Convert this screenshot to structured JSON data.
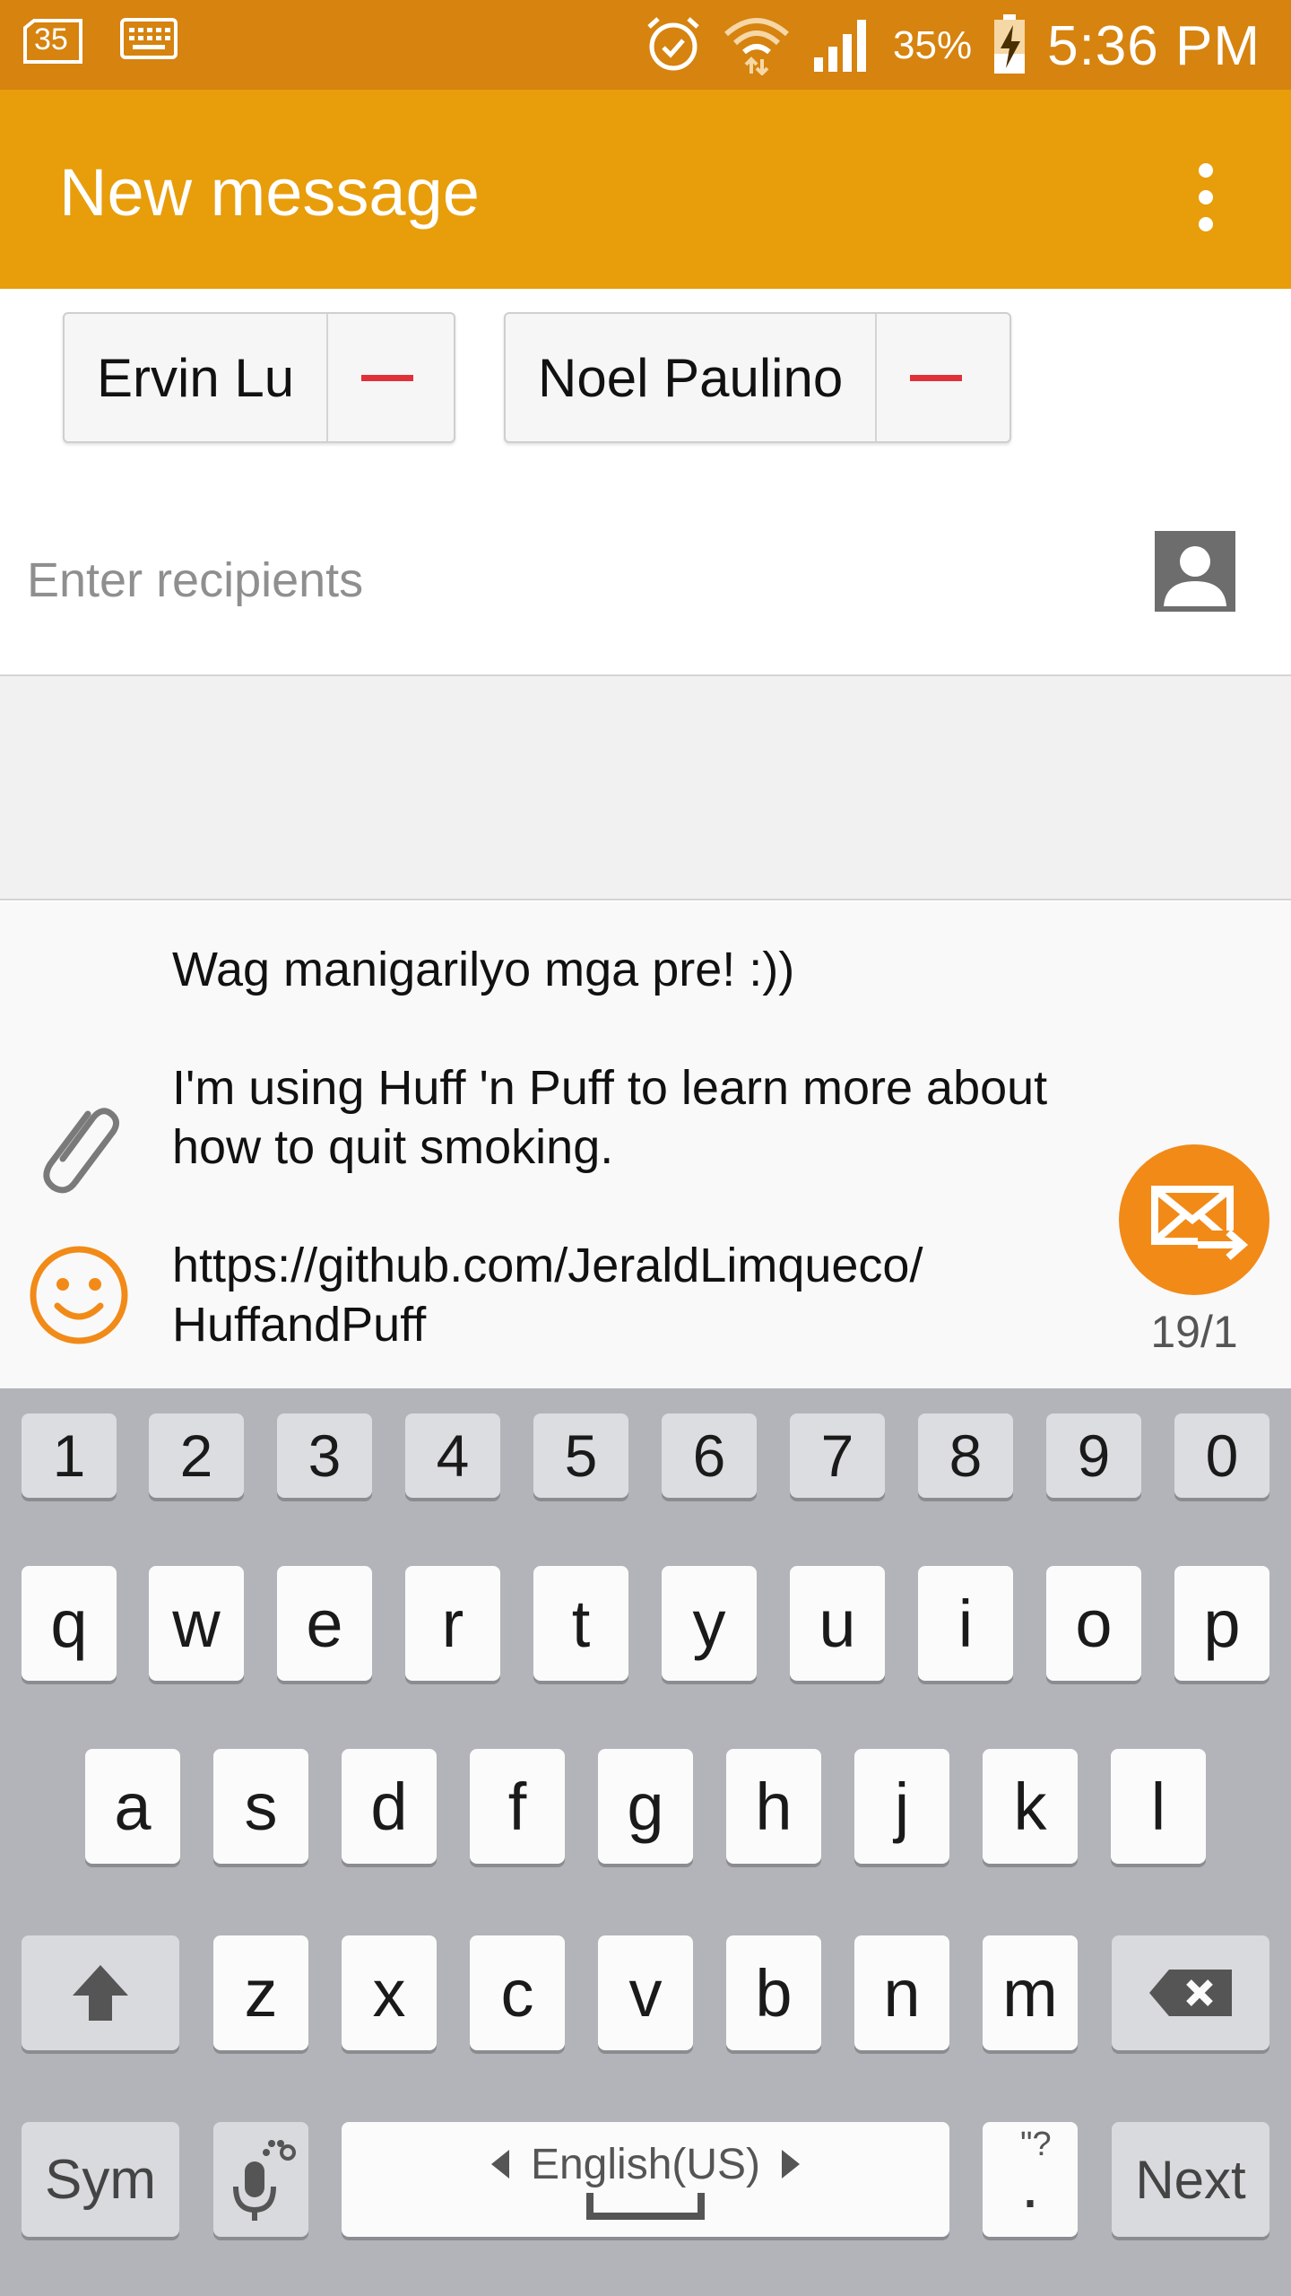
{
  "status_bar": {
    "notif_count": "35",
    "battery_percent": "35%",
    "time": "5:36 PM",
    "battery_level": 0.35,
    "icons": [
      "sim-badge-icon",
      "keyboard-icon",
      "alarm-icon",
      "wifi-icon",
      "signal-icon",
      "battery-charging-icon"
    ]
  },
  "app_bar": {
    "title": "New message",
    "menu_icon": "more-vert-icon"
  },
  "recipients": {
    "chips": [
      {
        "name": "Ervin Lu"
      },
      {
        "name": "Noel Paulino"
      }
    ],
    "input_placeholder": "Enter recipients",
    "contact_icon": "contact-picker-icon"
  },
  "compose": {
    "line1": "Wag manigarilyo mga pre! :))",
    "line2": "I'm using Huff 'n Puff to learn more about\nhow to quit smoking.",
    "line3": "https://github.com/JeraldLimqueco/\nHuffandPuff",
    "counter": "19/1",
    "attach_icon": "paperclip-icon",
    "emoji_icon": "smiley-icon",
    "send_icon": "send-mail-icon"
  },
  "keyboard": {
    "numbers": [
      "1",
      "2",
      "3",
      "4",
      "5",
      "6",
      "7",
      "8",
      "9",
      "0"
    ],
    "row1": [
      "q",
      "w",
      "e",
      "r",
      "t",
      "y",
      "u",
      "i",
      "o",
      "p"
    ],
    "row2": [
      "a",
      "s",
      "d",
      "f",
      "g",
      "h",
      "j",
      "k",
      "l"
    ],
    "row3": [
      "z",
      "x",
      "c",
      "v",
      "b",
      "n",
      "m"
    ],
    "sym_label": "Sym",
    "language": "English(US)",
    "period_label": ".",
    "period_hint": "\"?",
    "next_label": "Next"
  },
  "colors": {
    "status_bar": "#d6830f",
    "app_bar": "#e89d0b",
    "accent": "#f28a18",
    "chip_remove": "#e0303a"
  }
}
